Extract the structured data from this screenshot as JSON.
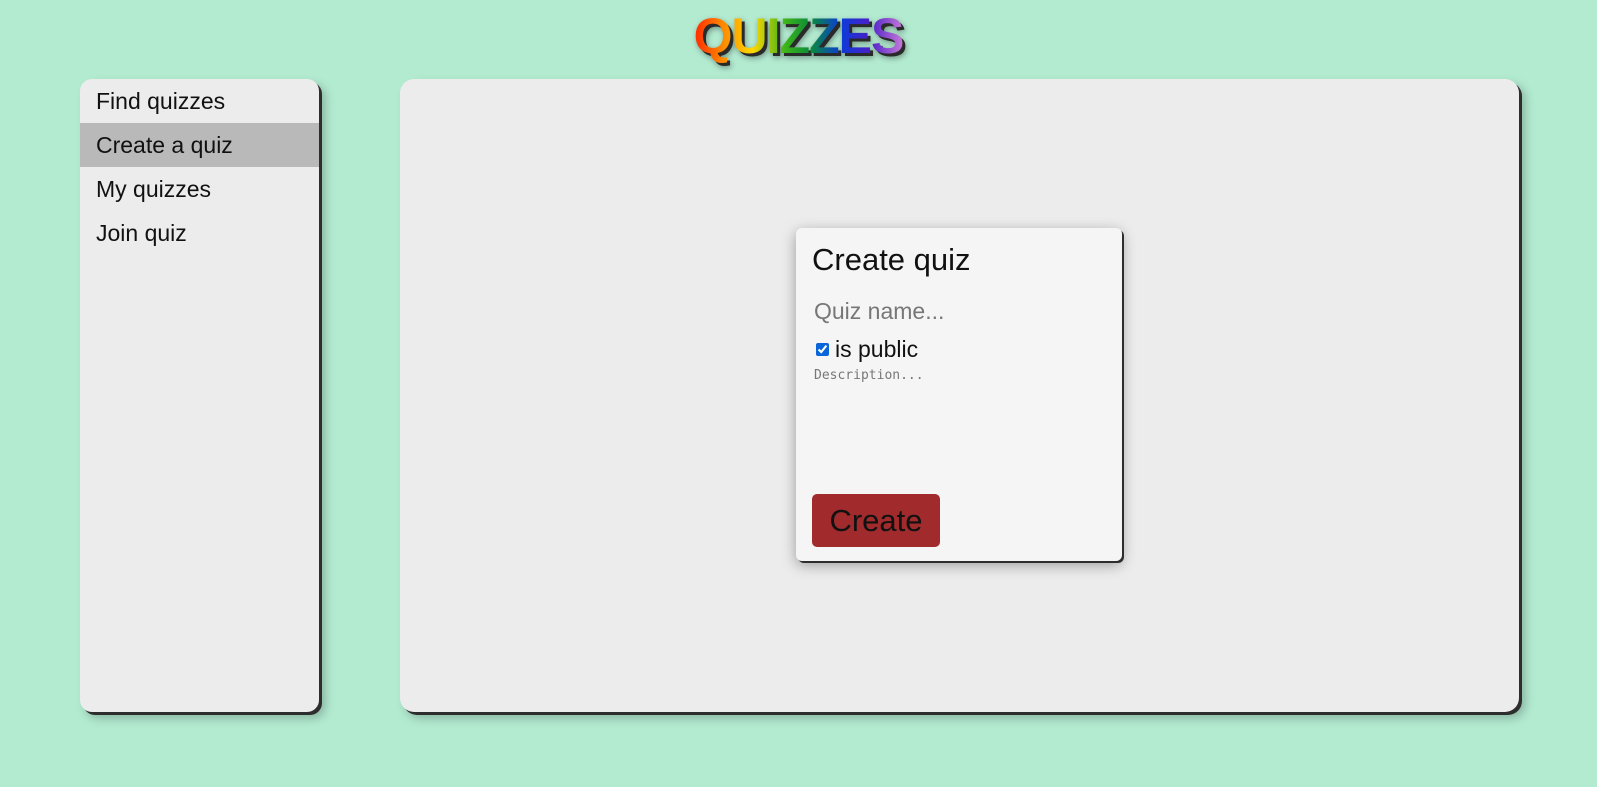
{
  "header": {
    "logo_text": "QUIZZES"
  },
  "sidebar": {
    "items": [
      {
        "label": "Find quizzes",
        "active": false
      },
      {
        "label": "Create a quiz",
        "active": true
      },
      {
        "label": "My quizzes",
        "active": false
      },
      {
        "label": "Join quiz",
        "active": false
      }
    ]
  },
  "create_quiz": {
    "title": "Create quiz",
    "name_placeholder": "Quiz name...",
    "name_value": "",
    "public_label": "is public",
    "public_checked": true,
    "description_placeholder": "Description...",
    "description_value": "",
    "create_label": "Create"
  },
  "colors": {
    "background": "#b3ebd1",
    "panel": "#ececec",
    "card": "#f5f5f5",
    "active_item": "#b9b9b9",
    "create_button": "#a02a2c"
  }
}
